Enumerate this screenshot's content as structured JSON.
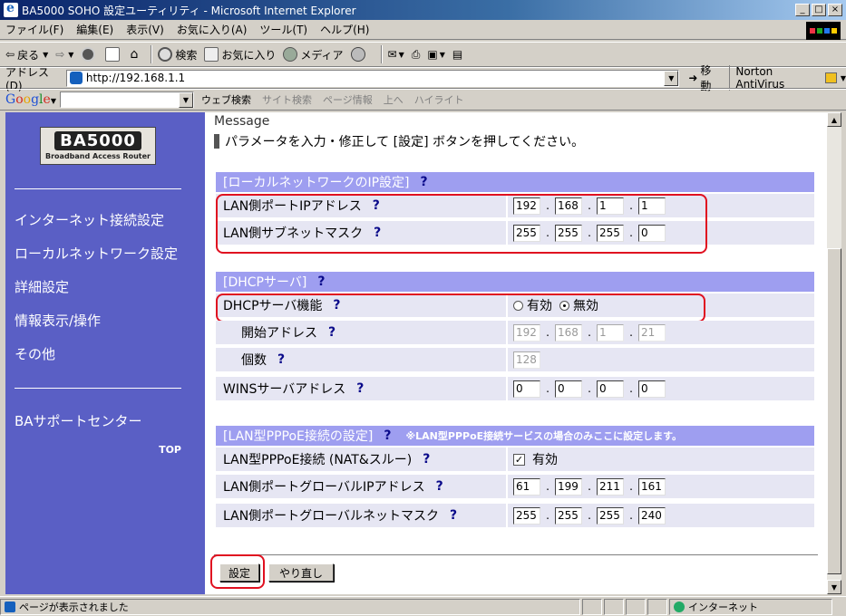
{
  "window": {
    "title": "BA5000 SOHO 設定ユーティリティ - Microsoft Internet Explorer"
  },
  "menu": [
    "ファイル(F)",
    "編集(E)",
    "表示(V)",
    "お気に入り(A)",
    "ツール(T)",
    "ヘルプ(H)"
  ],
  "toolbar": {
    "back": "戻る",
    "search": "検索",
    "favorites": "お気に入り",
    "media": "メディア"
  },
  "address": {
    "label": "アドレス(D)",
    "url": "http://192.168.1.1",
    "go": "移動",
    "norton": "Norton AntiVirus"
  },
  "googlebar": {
    "logo": [
      "G",
      "o",
      "o",
      "g",
      "l",
      "e"
    ],
    "web_search": "ウェブ検索",
    "site_search": "サイト検索",
    "page_info": "ページ情報",
    "up": "上へ",
    "highlight": "ハイライト"
  },
  "sidebar": {
    "logo_main": "BA5000",
    "logo_sub": "Broadband Access Router",
    "links": [
      "インターネット接続設定",
      "ローカルネットワーク設定",
      "詳細設定",
      "情報表示/操作",
      "その他"
    ],
    "support": "BAサポートセンター",
    "top": "TOP"
  },
  "message": {
    "title": "Message",
    "text": "パラメータを入力・修正して [設定] ボタンを押してください。"
  },
  "sections": {
    "lan": {
      "header": "[ローカルネットワークのIP設定]",
      "ip_label": "LAN側ポートIPアドレス",
      "ip": [
        "192",
        "168",
        "1",
        "1"
      ],
      "mask_label": "LAN側サブネットマスク",
      "mask": [
        "255",
        "255",
        "255",
        "0"
      ]
    },
    "dhcp": {
      "header": "[DHCPサーバ]",
      "func_label": "DHCPサーバ機能",
      "opt_on": "有効",
      "opt_off": "無効",
      "selected": "無効",
      "start_label": "開始アドレス",
      "start": [
        "192",
        "168",
        "1",
        "21"
      ],
      "count_label": "個数",
      "count": "128",
      "wins_label": "WINSサーバアドレス",
      "wins": [
        "0",
        "0",
        "0",
        "0"
      ]
    },
    "pppoe": {
      "header": "[LAN型PPPoE接続の設定]",
      "note": "※LAN型PPPoE接続サービスの場合のみここに設定します。",
      "conn_label": "LAN型PPPoE接続 (NAT&スルー)",
      "conn_value": "有効",
      "conn_checked": true,
      "gip_label": "LAN側ポートグローバルIPアドレス",
      "gip": [
        "61",
        "199",
        "211",
        "161"
      ],
      "gmask_label": "LAN側ポートグローバルネットマスク",
      "gmask": [
        "255",
        "255",
        "255",
        "240"
      ]
    }
  },
  "q": "?",
  "buttons": {
    "submit": "設定",
    "reset": "やり直し"
  },
  "status": {
    "text": "ページが表示されました",
    "zone": "インターネット"
  }
}
